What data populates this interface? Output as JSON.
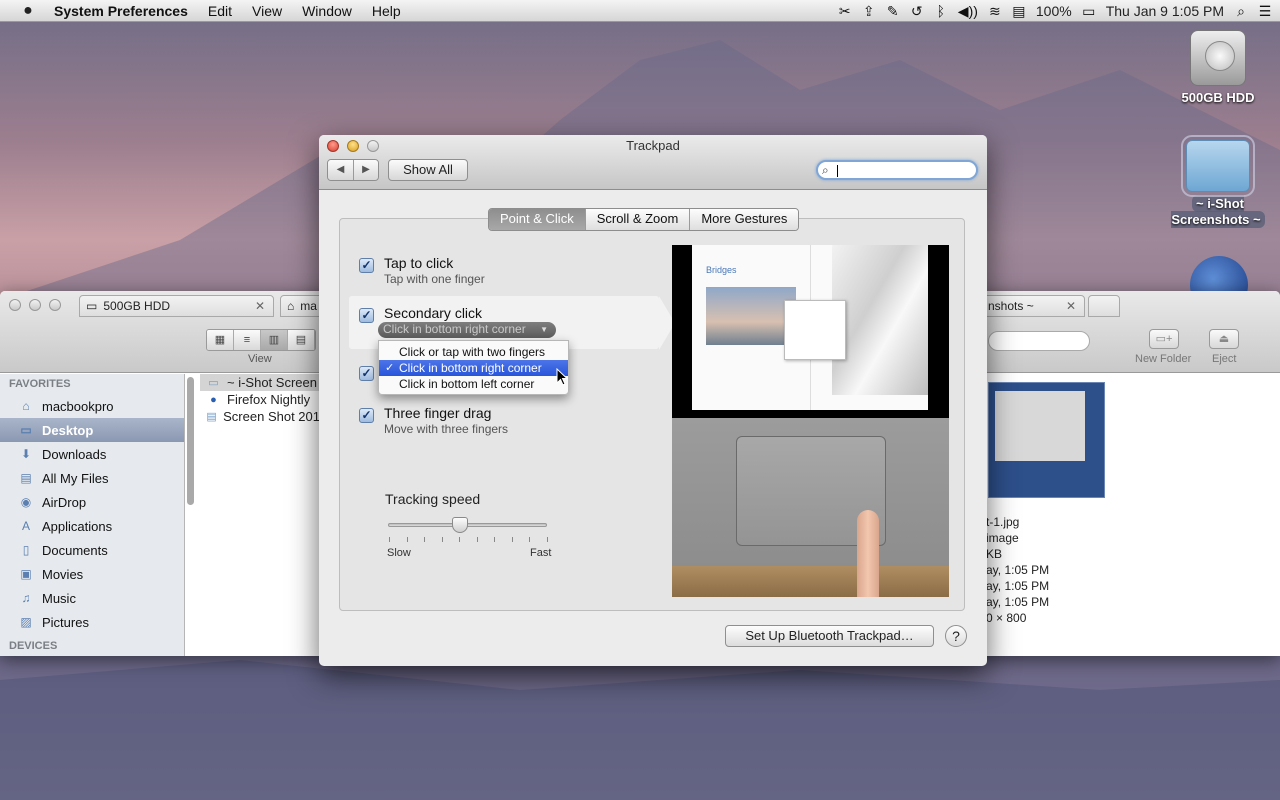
{
  "menubar": {
    "app_name": "System Preferences",
    "menus": [
      "Edit",
      "View",
      "Window",
      "Help"
    ],
    "battery": "100%",
    "datetime": "Thu Jan 9  1:05 PM"
  },
  "desktop": {
    "icons": [
      {
        "label": "500GB HDD"
      },
      {
        "label": "~ i-Shot Screenshots ~"
      }
    ]
  },
  "finder": {
    "tabs": [
      {
        "label": "500GB HDD"
      },
      {
        "label": "ma"
      },
      {
        "label": "nshots ~"
      }
    ],
    "view_label": "View",
    "new_folder_label": "New Folder",
    "eject_label": "Eject",
    "sidebar": {
      "favorites_header": "FAVORITES",
      "items": [
        {
          "label": "macbookpro",
          "icon": "home-icon"
        },
        {
          "label": "Desktop",
          "icon": "desktop-icon",
          "selected": true
        },
        {
          "label": "Downloads",
          "icon": "downloads-icon"
        },
        {
          "label": "All My Files",
          "icon": "all-files-icon"
        },
        {
          "label": "AirDrop",
          "icon": "airdrop-icon"
        },
        {
          "label": "Applications",
          "icon": "applications-icon"
        },
        {
          "label": "Documents",
          "icon": "documents-icon"
        },
        {
          "label": "Movies",
          "icon": "movies-icon"
        },
        {
          "label": "Music",
          "icon": "music-icon"
        },
        {
          "label": "Pictures",
          "icon": "pictures-icon"
        }
      ],
      "devices_header": "DEVICES"
    },
    "column": [
      {
        "label": "~ i-Shot Screen",
        "icon": "folder-icon"
      },
      {
        "label": "Firefox Nightly",
        "icon": "firefox-icon"
      },
      {
        "label": "Screen Shot 201",
        "icon": "file-icon"
      }
    ],
    "info_lines": [
      "t-1.jpg",
      "image",
      "KB",
      "ay, 1:05 PM",
      "ay, 1:05 PM",
      "ay, 1:05 PM",
      "0 × 800"
    ]
  },
  "trackpad": {
    "title": "Trackpad",
    "back_glyph": "◀",
    "forward_glyph": "▶",
    "show_all": "Show All",
    "search_value": "",
    "tabs": [
      {
        "label": "Point & Click",
        "selected": true
      },
      {
        "label": "Scroll & Zoom",
        "selected": false
      },
      {
        "label": "More Gestures",
        "selected": false
      }
    ],
    "options": {
      "tap": {
        "label": "Tap to click",
        "sub": "Tap with one finger",
        "checked": true
      },
      "secondary": {
        "label": "Secondary click",
        "value": "Click in bottom right corner",
        "checked": true
      },
      "third": {
        "checked": true
      },
      "drag": {
        "label": "Three finger drag",
        "sub": "Move with three fingers",
        "checked": true
      }
    },
    "popup_menu": [
      {
        "label": "Click or tap with two fingers",
        "selected": false
      },
      {
        "label": "Click in bottom right corner",
        "selected": true
      },
      {
        "label": "Click in bottom left corner",
        "selected": false
      }
    ],
    "tracking": {
      "label": "Tracking speed",
      "min_label": "Slow",
      "max_label": "Fast",
      "level": 0.45
    },
    "preview_title": "Bridges",
    "bluetooth_button": "Set Up Bluetooth Trackpad…",
    "help_glyph": "?"
  }
}
